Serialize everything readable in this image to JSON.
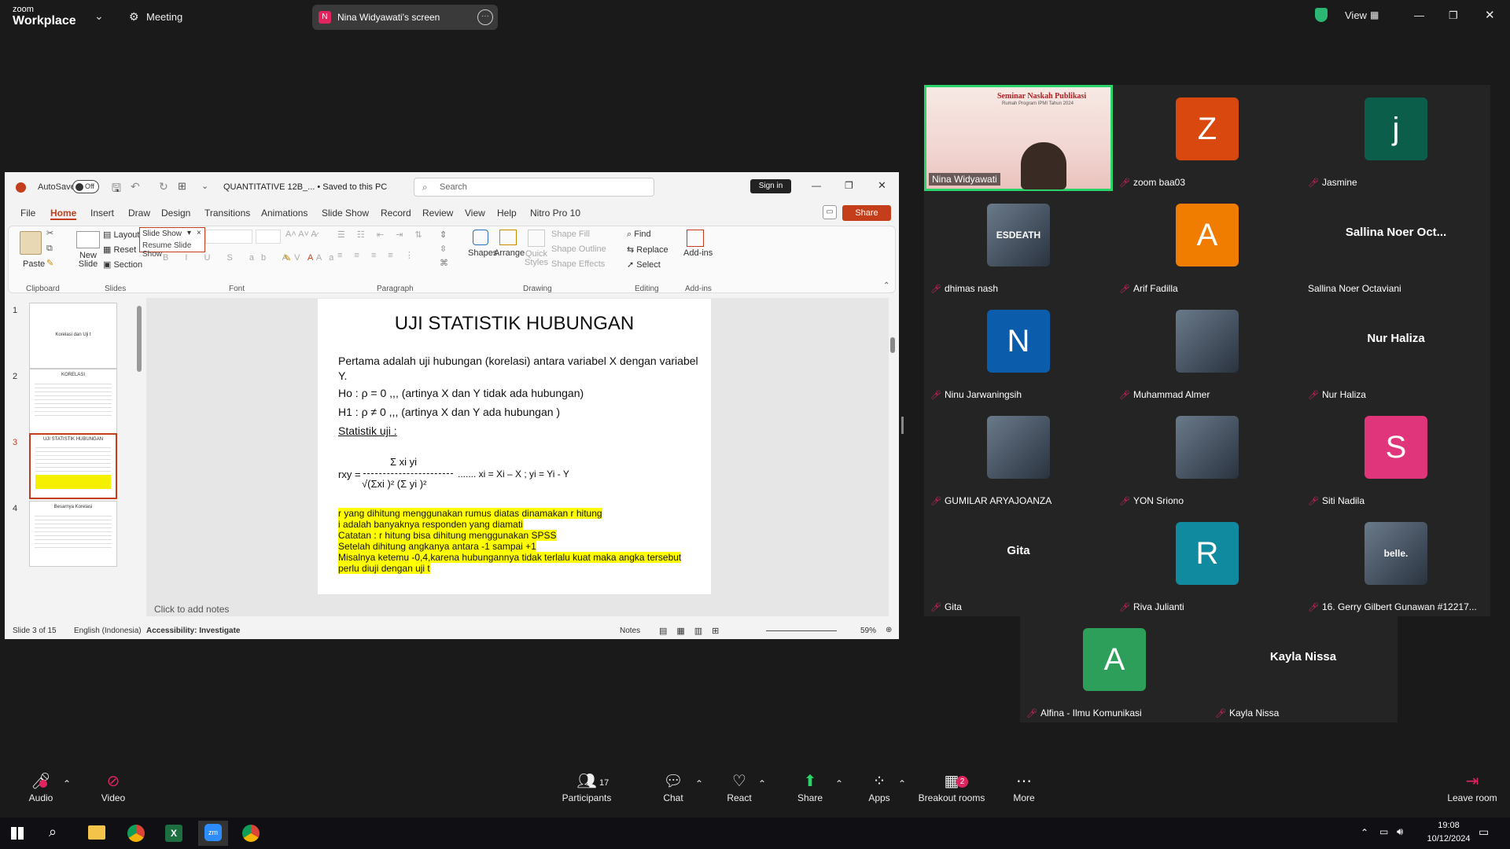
{
  "zoom": {
    "logo_top": "zoom",
    "logo_bottom": "Workplace",
    "meeting_label": "Meeting",
    "share_badge": "N",
    "share_label": "Nina Widyawati's screen",
    "view_label": "View",
    "shield_color": "#2bb673"
  },
  "ppt": {
    "autosave_label": "AutoSave",
    "autosave_state": "Off",
    "file_title": "QUANTITATIVE 12B_... • Saved to this PC",
    "search_placeholder": "Search",
    "sign_in": "Sign in",
    "menu": [
      "File",
      "Home",
      "Insert",
      "Draw",
      "Design",
      "Transitions",
      "Animations",
      "Slide Show",
      "Record",
      "Review",
      "View",
      "Help",
      "Nitro Pro 10"
    ],
    "share_button": "Share",
    "ribbon": {
      "paste": "Paste",
      "new_slide": "New Slide",
      "layout": "Layout",
      "reset": "Reset",
      "section": "Section",
      "slideshow_popup": "Slide Show",
      "resume_slideshow": "Resume Slide Show",
      "shapes": "Shapes",
      "arrange": "Arrange",
      "quick_styles": "Quick Styles",
      "shape_fill": "Shape Fill",
      "shape_outline": "Shape Outline",
      "shape_effects": "Shape Effects",
      "find": "Find",
      "replace": "Replace",
      "select": "Select",
      "add_ins": "Add-ins",
      "groups": [
        "Clipboard",
        "Slides",
        "Font",
        "Paragraph",
        "Drawing",
        "Editing",
        "Add-ins"
      ]
    },
    "thumbnails": [
      {
        "num": "1",
        "text": "Korelasi dan Uji t"
      },
      {
        "num": "2",
        "text": "KORELASI"
      },
      {
        "num": "3",
        "text": "UJI STATISTIK HUBUNGAN"
      },
      {
        "num": "4",
        "text": "Besarnya Korelasi"
      }
    ],
    "slide": {
      "title": "UJI STATISTIK HUBUNGAN",
      "line1": "Pertama adalah uji hubungan (korelasi) antara variabel  X dengan variabel  Y.",
      "line2": "Ho : ρ = 0  ,,, (artinya X dan Y tidak ada hubungan)",
      "line3": "H1 : ρ ≠ 0  ,,, (artinya X dan Y ada hubungan )",
      "line4": "Statistik uji :",
      "formula_num": "Σ xi yi",
      "formula_lhs": "rxy =",
      "formula_den": "√(Σxi )²  (Σ yi )²",
      "formula_rhs": "....... xi = Xi – X  ; yi = Yi - Y",
      "hl1": "r yang dihitung menggunakan rumus diatas dinamakan r hitung",
      "hl2": "i adalah banyaknya responden yang diamati",
      "hl3": "Catatan :  r hitung bisa dihitung menggunakan SPSS",
      "hl4": "Setelah dihitung angkanya antara -1 sampai +1",
      "hl5": "Misalnya ketemu -0,4,karena hubungannya tidak terlalu kuat maka angka tersebut perlu diuji  dengan uji t"
    },
    "notes_placeholder": "Click to add notes",
    "status": {
      "slide_of": "Slide 3 of 15",
      "language": "English (Indonesia)",
      "accessibility": "Accessibility: Investigate",
      "notes": "Notes",
      "zoom": "59%"
    }
  },
  "participants": [
    {
      "name": "Nina Widyawati",
      "kind": "video"
    },
    {
      "name": "zoom baa03",
      "kind": "avatar",
      "letter": "Z",
      "color": "#d9480f"
    },
    {
      "name": "Jasmine",
      "kind": "avatar",
      "letter": "j",
      "color": "#0b5f4a"
    },
    {
      "name": "dhimas nash",
      "kind": "photo",
      "photo_text": "ESDEATH"
    },
    {
      "name": "Arif Fadilla",
      "kind": "avatar",
      "letter": "A",
      "color": "#f07c00"
    },
    {
      "name": "Sallina Noer Octaviani",
      "kind": "text",
      "big": "Sallina  Noer  Oct..."
    },
    {
      "name": "Ninu Jarwaningsih",
      "kind": "avatar",
      "letter": "N",
      "color": "#0b5cab"
    },
    {
      "name": "Muhammad Almer",
      "kind": "photo"
    },
    {
      "name": "Nur Haliza",
      "kind": "text",
      "big": "Nur Haliza"
    },
    {
      "name": "GUMILAR ARYAJOANZA",
      "kind": "photo"
    },
    {
      "name": "YON Sriono",
      "kind": "photo"
    },
    {
      "name": "Siti Nadila",
      "kind": "avatar",
      "letter": "S",
      "color": "#e0357a"
    },
    {
      "name": "Gita",
      "kind": "text",
      "big": "Gita"
    },
    {
      "name": "Riva Julianti",
      "kind": "avatar",
      "letter": "R",
      "color": "#0f8a9e"
    },
    {
      "name": "16. Gerry Gilbert Gunawan #12217...",
      "kind": "photo",
      "photo_text": "belle."
    },
    {
      "name": "Alfina - Ilmu Komunikasi",
      "kind": "avatar",
      "letter": "A",
      "color": "#2e9e5b"
    },
    {
      "name": "Kayla Nissa",
      "kind": "text",
      "big": "Kayla Nissa"
    }
  ],
  "video_tile_text": {
    "seminar_title": "Seminar Naskah Publikasi",
    "seminar_sub": "Rumah Program IPMI Tahun 2024"
  },
  "toolbar": {
    "audio": "Audio",
    "video": "Video",
    "participants": "Participants",
    "participant_count": "17",
    "chat": "Chat",
    "react": "React",
    "share": "Share",
    "apps": "Apps",
    "breakout": "Breakout rooms",
    "breakout_badge": "2",
    "more": "More",
    "leave": "Leave room"
  },
  "taskbar": {
    "time": "19:08",
    "date": "10/12/2024"
  }
}
